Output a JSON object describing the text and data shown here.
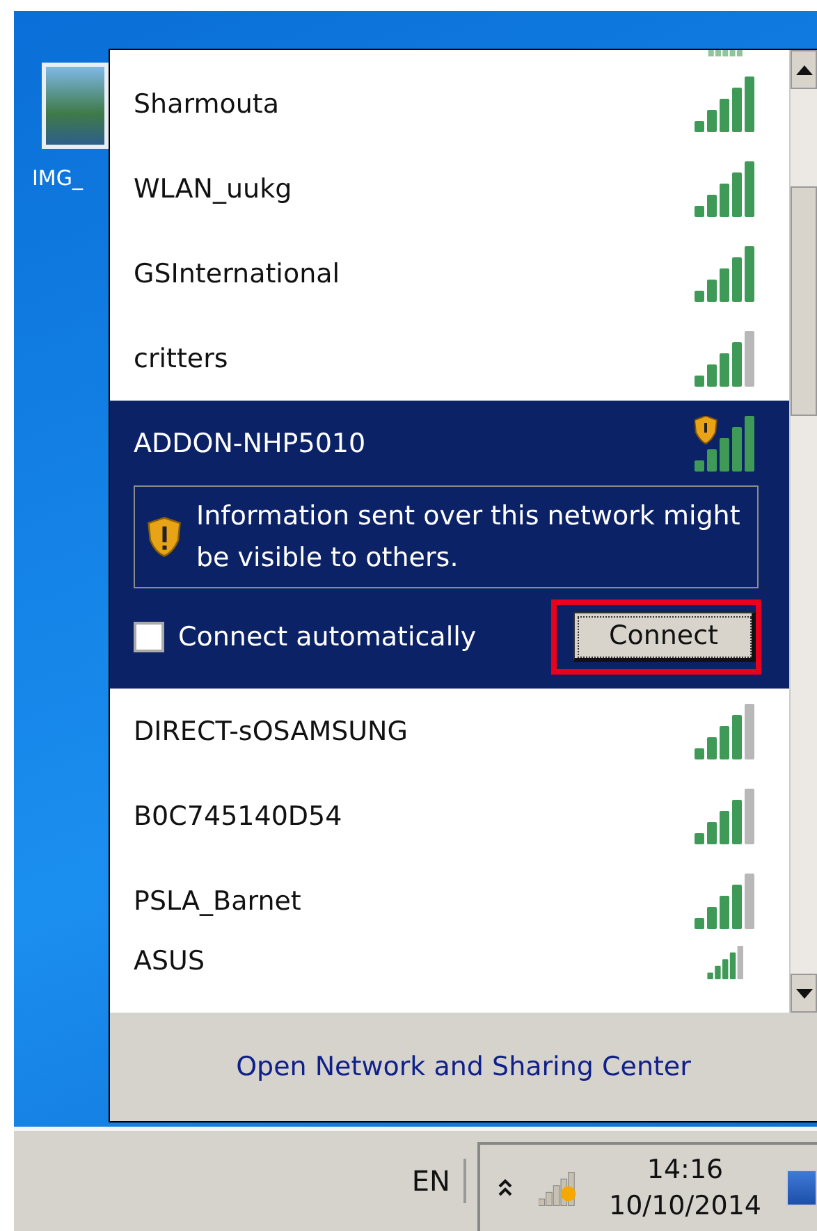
{
  "desktop_icon": {
    "label": "IMG_"
  },
  "networks": [
    {
      "name": "Sharmouta",
      "kind": "full",
      "selected": false
    },
    {
      "name": "WLAN_uukg",
      "kind": "full",
      "selected": false
    },
    {
      "name": "GSInternational",
      "kind": "full",
      "selected": false
    },
    {
      "name": "critters",
      "kind": "good",
      "selected": false
    },
    {
      "name": "ADDON-NHP5010",
      "kind": "open",
      "selected": true,
      "warning": "Information sent over this network might be visible to others.",
      "auto_connect": {
        "label": "Connect automatically",
        "checked": false
      },
      "button": "Connect"
    },
    {
      "name": "DIRECT-sOSAMSUNG",
      "kind": "good",
      "selected": false
    },
    {
      "name": "B0C745140D54",
      "kind": "good",
      "selected": false
    },
    {
      "name": "PSLA_Barnet",
      "kind": "good",
      "selected": false
    },
    {
      "name": "ASUS",
      "kind": "good",
      "selected": false
    }
  ],
  "footer_link": "Open Network and Sharing Center",
  "taskbar": {
    "language": "EN",
    "time": "14:16",
    "date": "10/10/2014"
  }
}
